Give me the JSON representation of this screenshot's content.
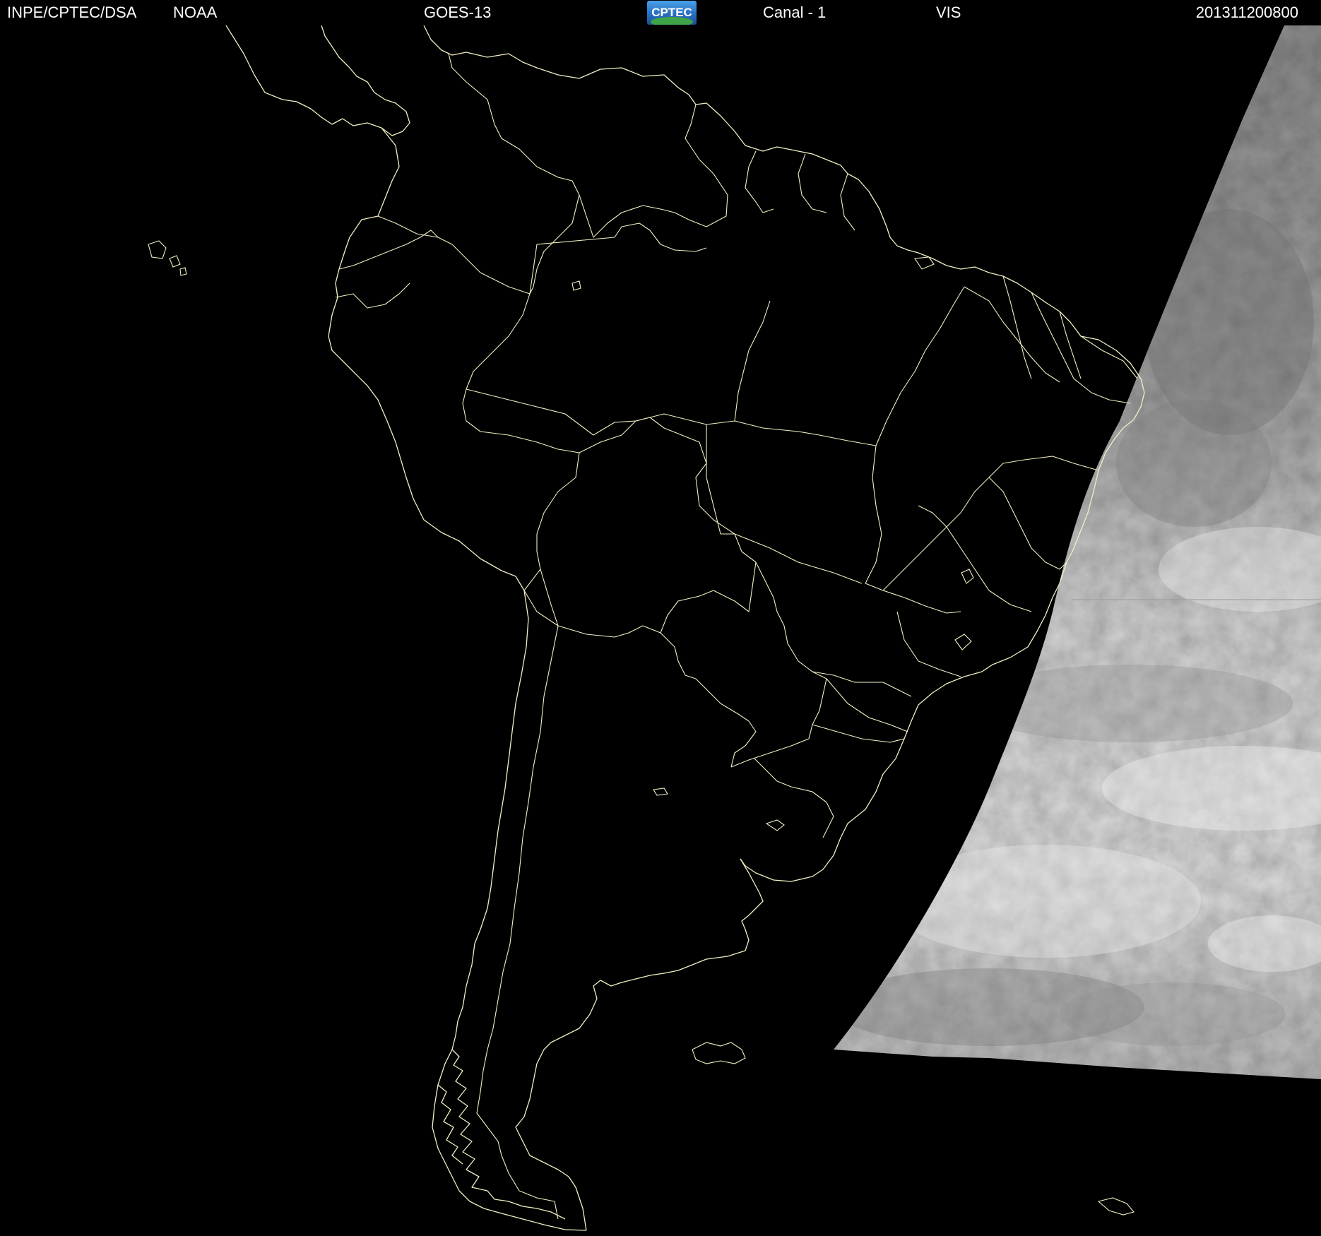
{
  "header": {
    "institution": "INPE/CPTEC/DSA",
    "agency": "NOAA",
    "satellite": "GOES-13",
    "logo_text": "CPTEC",
    "channel": "Canal - 1",
    "band": "VIS",
    "timestamp": "201311200800"
  },
  "map": {
    "region": "South America",
    "layers": [
      "coastlines",
      "country-borders",
      "brazil-state-borders",
      "satellite-visible-imagery"
    ],
    "line_color": "#f3efc4",
    "background_color": "#000000",
    "imagery_tone": "#d8d8d8"
  },
  "icons": {
    "logo": "cptec-logo"
  }
}
